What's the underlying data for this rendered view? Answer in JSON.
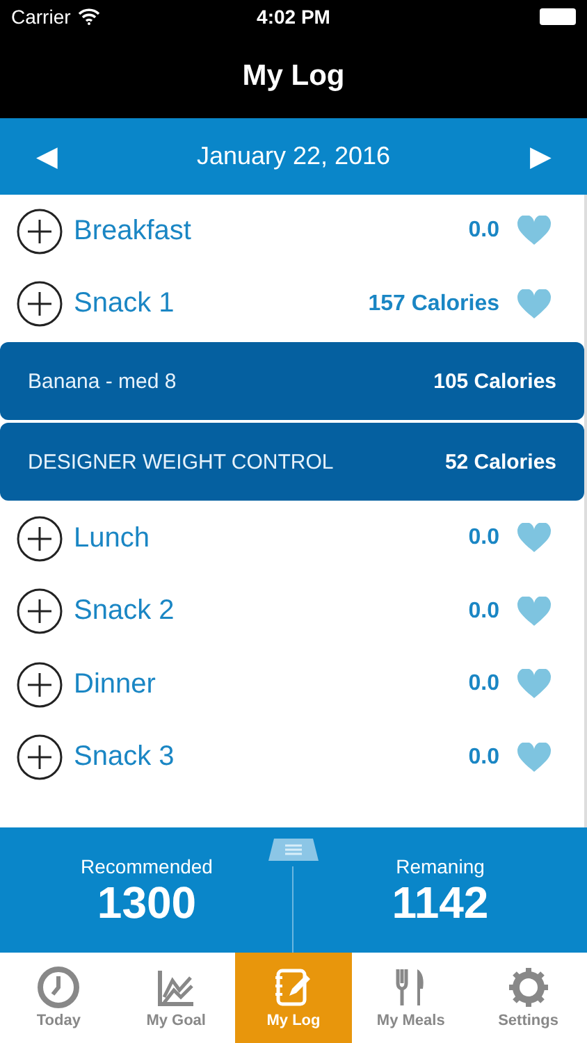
{
  "status_bar": {
    "carrier": "Carrier",
    "time": "4:02 PM"
  },
  "title": "My Log",
  "date_bar": {
    "prev": "◀",
    "date": "January 22, 2016",
    "next": "▶"
  },
  "meals": [
    {
      "name": "Breakfast",
      "total": "0.0"
    },
    {
      "name": "Snack 1",
      "total": "157 Calories",
      "items": [
        {
          "name": "Banana - med 8",
          "calories": "105 Calories"
        },
        {
          "name": "DESIGNER WEIGHT CONTROL",
          "calories": "52 Calories"
        }
      ]
    },
    {
      "name": "Lunch",
      "total": "0.0"
    },
    {
      "name": "Snack 2",
      "total": "0.0"
    },
    {
      "name": "Dinner",
      "total": "0.0"
    },
    {
      "name": "Snack 3",
      "total": "0.0"
    }
  ],
  "summary": {
    "recommended_label": "Recommended",
    "recommended": "1300",
    "remaining_label": "Remaning",
    "remaining": "1142"
  },
  "tabs": [
    {
      "kind": "today",
      "label": "Today",
      "selected": false
    },
    {
      "kind": "goal",
      "label": "My Goal",
      "selected": false
    },
    {
      "kind": "log",
      "label": "My Log",
      "selected": true
    },
    {
      "kind": "meals",
      "label": "My Meals",
      "selected": false
    },
    {
      "kind": "settings",
      "label": "Settings",
      "selected": false
    }
  ]
}
